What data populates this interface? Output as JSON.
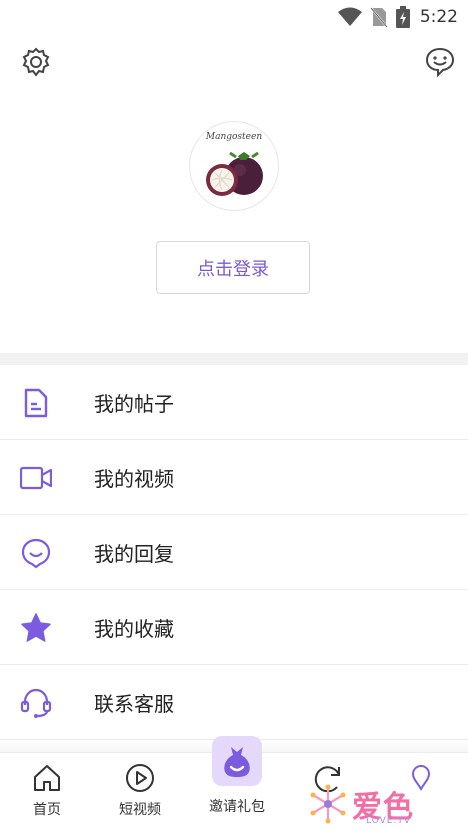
{
  "status_bar": {
    "time": "5:22"
  },
  "profile": {
    "avatar_brand": "Mangosteen",
    "login_label": "点击登录"
  },
  "menu": {
    "items": [
      {
        "label": "我的帖子",
        "icon": "document-icon"
      },
      {
        "label": "我的视频",
        "icon": "video-camera-icon"
      },
      {
        "label": "我的回复",
        "icon": "smile-chat-icon"
      },
      {
        "label": "我的收藏",
        "icon": "star-icon"
      },
      {
        "label": "联系客服",
        "icon": "headset-icon"
      }
    ]
  },
  "tabbar": {
    "tabs": [
      {
        "label": "首页",
        "icon": "home-icon"
      },
      {
        "label": "短视频",
        "icon": "play-circle-icon"
      },
      {
        "label": "邀请礼包",
        "icon": "gift-bag-icon"
      },
      {
        "label": "",
        "icon": "refresh-icon"
      },
      {
        "label": "",
        "icon": "profile-icon"
      }
    ]
  },
  "watermark": {
    "text": "爱色",
    "sub": "LOVE.TV"
  },
  "colors": {
    "accent": "#7a5ad6",
    "icon_purple": "#7b5ce0",
    "divider": "#f2f2f2"
  }
}
